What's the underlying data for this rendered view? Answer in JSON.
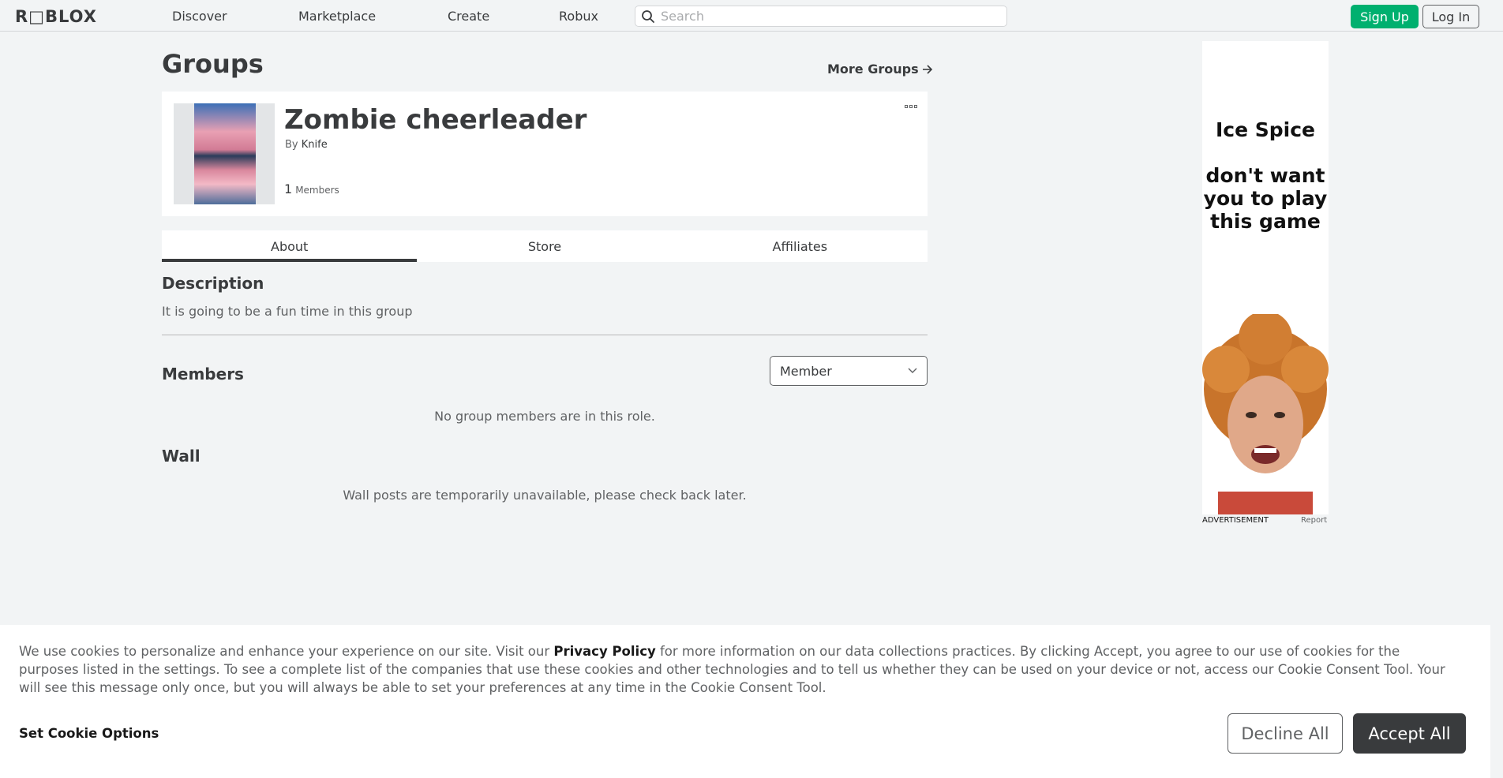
{
  "nav": {
    "logo": "R□BLOX",
    "links": [
      "Discover",
      "Marketplace",
      "Create",
      "Robux"
    ],
    "search_placeholder": "Search",
    "signup_label": "Sign Up",
    "login_label": "Log In"
  },
  "page": {
    "title": "Groups",
    "more_groups": "More Groups"
  },
  "group": {
    "name": "Zombie cheerleader",
    "by_label": "By",
    "owner": "Knife",
    "member_count": "1",
    "members_label": "Members"
  },
  "tabs": [
    "About",
    "Store",
    "Affiliates"
  ],
  "active_tab": "About",
  "about": {
    "description_title": "Description",
    "description_text": "It is going to be a fun time in this group",
    "members_title": "Members",
    "role_selected": "Member",
    "no_members_text": "No group members are in this role.",
    "wall_title": "Wall",
    "wall_text": "Wall posts are temporarily unavailable, please check back later."
  },
  "ad": {
    "headline": "Ice Spice",
    "body": "don't want you to play this game",
    "label": "ADVERTISEMENT",
    "report": "Report"
  },
  "cookie": {
    "text_before": "We use cookies to personalize and enhance your experience on our site. Visit our ",
    "privacy_link": "Privacy Policy",
    "text_after": " for more information on our data collections practices. By clicking Accept, you agree to our use of cookies for the purposes listed in the settings. To see a complete list of the companies that use these cookies and other technologies and to tell us whether they can be used on your device or not, access our Cookie Consent Tool. Your will see this message only once, but you will always be able to set your preferences at any time in the Cookie Consent Tool.",
    "options_label": "Set Cookie Options",
    "decline_label": "Decline All",
    "accept_label": "Accept All"
  },
  "colors": {
    "accent_green": "#00b06f",
    "text_dark": "#393b3d",
    "background": "#f2f4f5"
  }
}
